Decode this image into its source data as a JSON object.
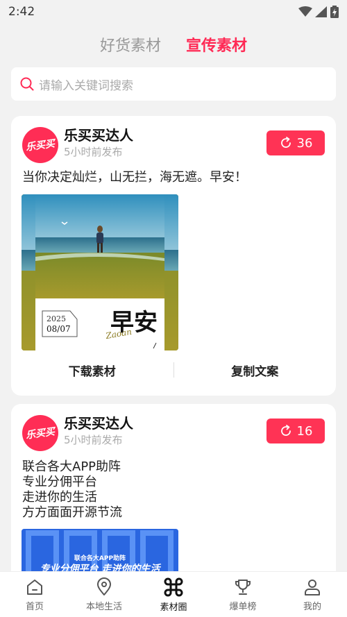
{
  "status": {
    "time": "2:42"
  },
  "tabs": [
    {
      "label": "好货素材",
      "active": false
    },
    {
      "label": "宣传素材",
      "active": true
    }
  ],
  "search": {
    "placeholder": "请输入关键词搜索"
  },
  "posts": [
    {
      "avatar_text": "乐买买",
      "author": "乐买买达人",
      "time": "5小时前发布",
      "share_count": "36",
      "text": "当你决定灿烂，山无拦，海无遮。早安！",
      "image": {
        "date_year": "2025",
        "date_md": "08/07",
        "title": "早安",
        "script": "Zaoan"
      },
      "actions": {
        "download": "下载素材",
        "copy": "复制文案"
      }
    },
    {
      "avatar_text": "乐买买",
      "author": "乐买买达人",
      "time": "5小时前发布",
      "share_count": "16",
      "lines": [
        "联合各大APP助阵",
        "专业分佣平台",
        "走进你的生活",
        "方方面面开源节流"
      ],
      "image": {
        "tagline": "联合各大APP助阵",
        "headline": "专业分佣平台 走进你的生活"
      }
    }
  ],
  "nav": [
    {
      "label": "首页",
      "icon": "home-icon"
    },
    {
      "label": "本地生活",
      "icon": "location-icon"
    },
    {
      "label": "素材圈",
      "icon": "command-icon",
      "active": true
    },
    {
      "label": "爆单榜",
      "icon": "trophy-icon"
    },
    {
      "label": "我的",
      "icon": "user-icon"
    }
  ],
  "colors": {
    "accent": "#ff2a55",
    "share_button": "#ff3355"
  }
}
